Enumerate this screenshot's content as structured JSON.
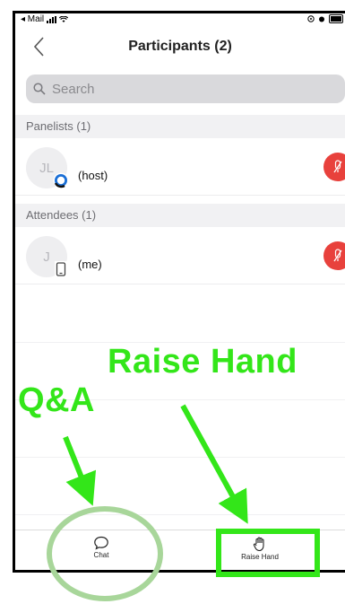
{
  "status_bar": {
    "carrier": "◂ Mail"
  },
  "header": {
    "title": "Participants (2)"
  },
  "search": {
    "placeholder": "Search"
  },
  "sections": {
    "panelists": {
      "label": "Panelists (1)",
      "participant": {
        "initials": "JL",
        "name": "(host)"
      }
    },
    "attendees": {
      "label": "Attendees (1)",
      "participant": {
        "initials": "J",
        "name": "(me)"
      }
    }
  },
  "tabbar": {
    "chat_label": "Chat",
    "raise_hand_label": "Raise Hand"
  },
  "annotations": {
    "raise_hand": "Raise Hand",
    "qa": "Q&A"
  },
  "colors": {
    "annotation_green": "#33e619",
    "mute_red": "#e8413c",
    "highlight_circle": "#a8d69a"
  },
  "icons": [
    "back-chevron-icon",
    "search-icon",
    "zoom-badge-icon",
    "phone-device-icon",
    "mic-muted-icon",
    "chat-bubble-icon",
    "raise-hand-icon"
  ]
}
